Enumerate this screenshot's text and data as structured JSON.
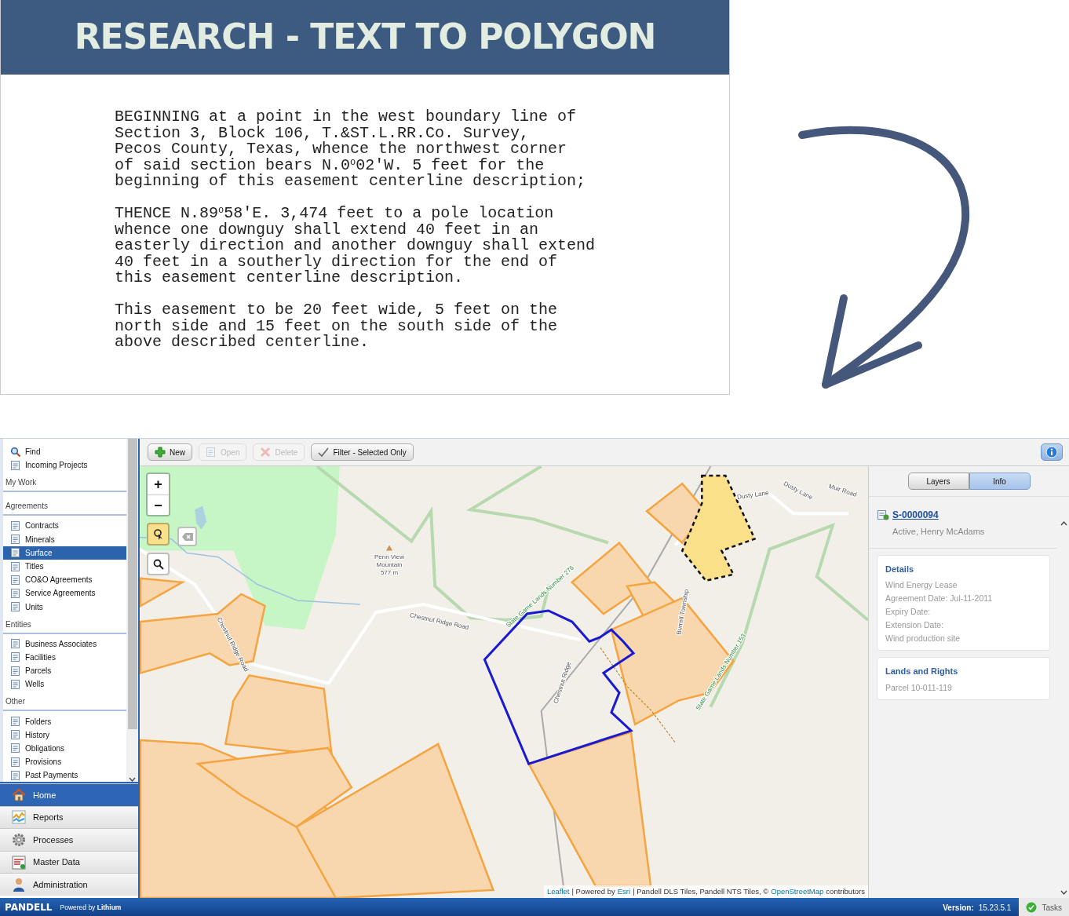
{
  "slide": {
    "title": "RESEARCH - TEXT TO POLYGON",
    "paragraphs": [
      "BEGINNING at a point in the west boundary line of\nSection 3, Block 106, T.&ST.L.RR.Co. Survey,\nPecos County, Texas, whence the northwest corner\nof said section bears N.0$^{o}$02'W. 5 feet for the\nbeginning of this easement centerline description;",
      "THENCE N.89$^{o}$58'E. 3,474 feet to a pole location\nwhence one downguy shall extend 40 feet in an\neasterly direction and another downguy shall extend\n40 feet in a southerly direction for the end of\nthis easement centerline description.",
      "This easement to be 20 feet wide, 5 feet on the\nnorth side and 15 feet on the south side of the\nabove described centerline."
    ]
  },
  "app": {
    "sidebar": {
      "top_items": [
        {
          "label": "Find",
          "selected": false
        },
        {
          "label": "Incoming Projects",
          "selected": false
        }
      ],
      "sections": [
        {
          "header": "My Work"
        },
        {
          "header": "Agreements",
          "items": [
            {
              "label": "Contracts",
              "selected": false
            },
            {
              "label": "Minerals",
              "selected": false
            },
            {
              "label": "Surface",
              "selected": true
            },
            {
              "label": "Titles",
              "selected": false
            },
            {
              "label": "CO&O Agreements",
              "selected": false
            },
            {
              "label": "Service Agreements",
              "selected": false
            },
            {
              "label": "Units",
              "selected": false
            }
          ]
        },
        {
          "header": "Entities",
          "items": [
            {
              "label": "Business Associates",
              "selected": false
            },
            {
              "label": "Facilities",
              "selected": false
            },
            {
              "label": "Parcels",
              "selected": false
            },
            {
              "label": "Wells",
              "selected": false
            }
          ]
        },
        {
          "header": "Other",
          "items": [
            {
              "label": "Folders",
              "selected": false
            },
            {
              "label": "History",
              "selected": false
            },
            {
              "label": "Obligations",
              "selected": false
            },
            {
              "label": "Provisions",
              "selected": false
            },
            {
              "label": "Past Payments",
              "selected": false
            }
          ]
        }
      ]
    },
    "nav": [
      {
        "label": "Home",
        "selected": true
      },
      {
        "label": "Reports",
        "selected": false
      },
      {
        "label": "Processes",
        "selected": false
      },
      {
        "label": "Master Data",
        "selected": false
      },
      {
        "label": "Administration",
        "selected": false
      }
    ],
    "toolbar": [
      {
        "label": "New",
        "disabled": false
      },
      {
        "label": "Open",
        "disabled": true
      },
      {
        "label": "Delete",
        "disabled": true
      },
      {
        "label": "Filter - Selected Only",
        "disabled": false
      }
    ],
    "map": {
      "zoom_in": "+",
      "zoom_out": "−",
      "select_tool": {
        "on": true
      },
      "labels": [
        "Penn View",
        "Mountain",
        "577 m",
        "Chestnut Ridge Road",
        "State Game Lands Number 276",
        "Burrell Township",
        "Chestnut Ridge",
        "State Game Lands Number 153",
        "Chestnut Ridge Road",
        "Dusty Lane",
        "Dusty Lane",
        "Muir Road"
      ],
      "attribution": [
        {
          "text": "Leaflet",
          "link": true
        },
        {
          "text": "| Powered by",
          "link": false
        },
        {
          "text": "Esri",
          "link": true
        },
        {
          "text": "| Pandell DLS Tiles, Pandell NTS Tiles, ©",
          "link": false
        },
        {
          "text": "OpenStreetMap",
          "link": true
        },
        {
          "text": "contributors",
          "link": false
        }
      ]
    },
    "panel": {
      "tabs": [
        {
          "label": "Layers",
          "selected": false
        },
        {
          "label": "Info",
          "selected": true
        }
      ],
      "record": {
        "id": "S-0000094",
        "subtitle": "Active, Henry McAdams"
      },
      "cards": [
        {
          "title": "Details",
          "lines": [
            "Wind Energy Lease",
            "Agreement Date: Jul-11-2011",
            "Expiry Date:",
            "Extension Date:",
            "Wind production site"
          ]
        },
        {
          "title": "Lands and Rights",
          "lines": [
            "Parcel 10-011-119"
          ]
        }
      ]
    },
    "status_bar": {
      "brand": "PANDELL",
      "powered": "Powered by **Lithium**",
      "version_label": "Version:",
      "version": "15.23.5.1",
      "tasks": "Tasks"
    }
  }
}
